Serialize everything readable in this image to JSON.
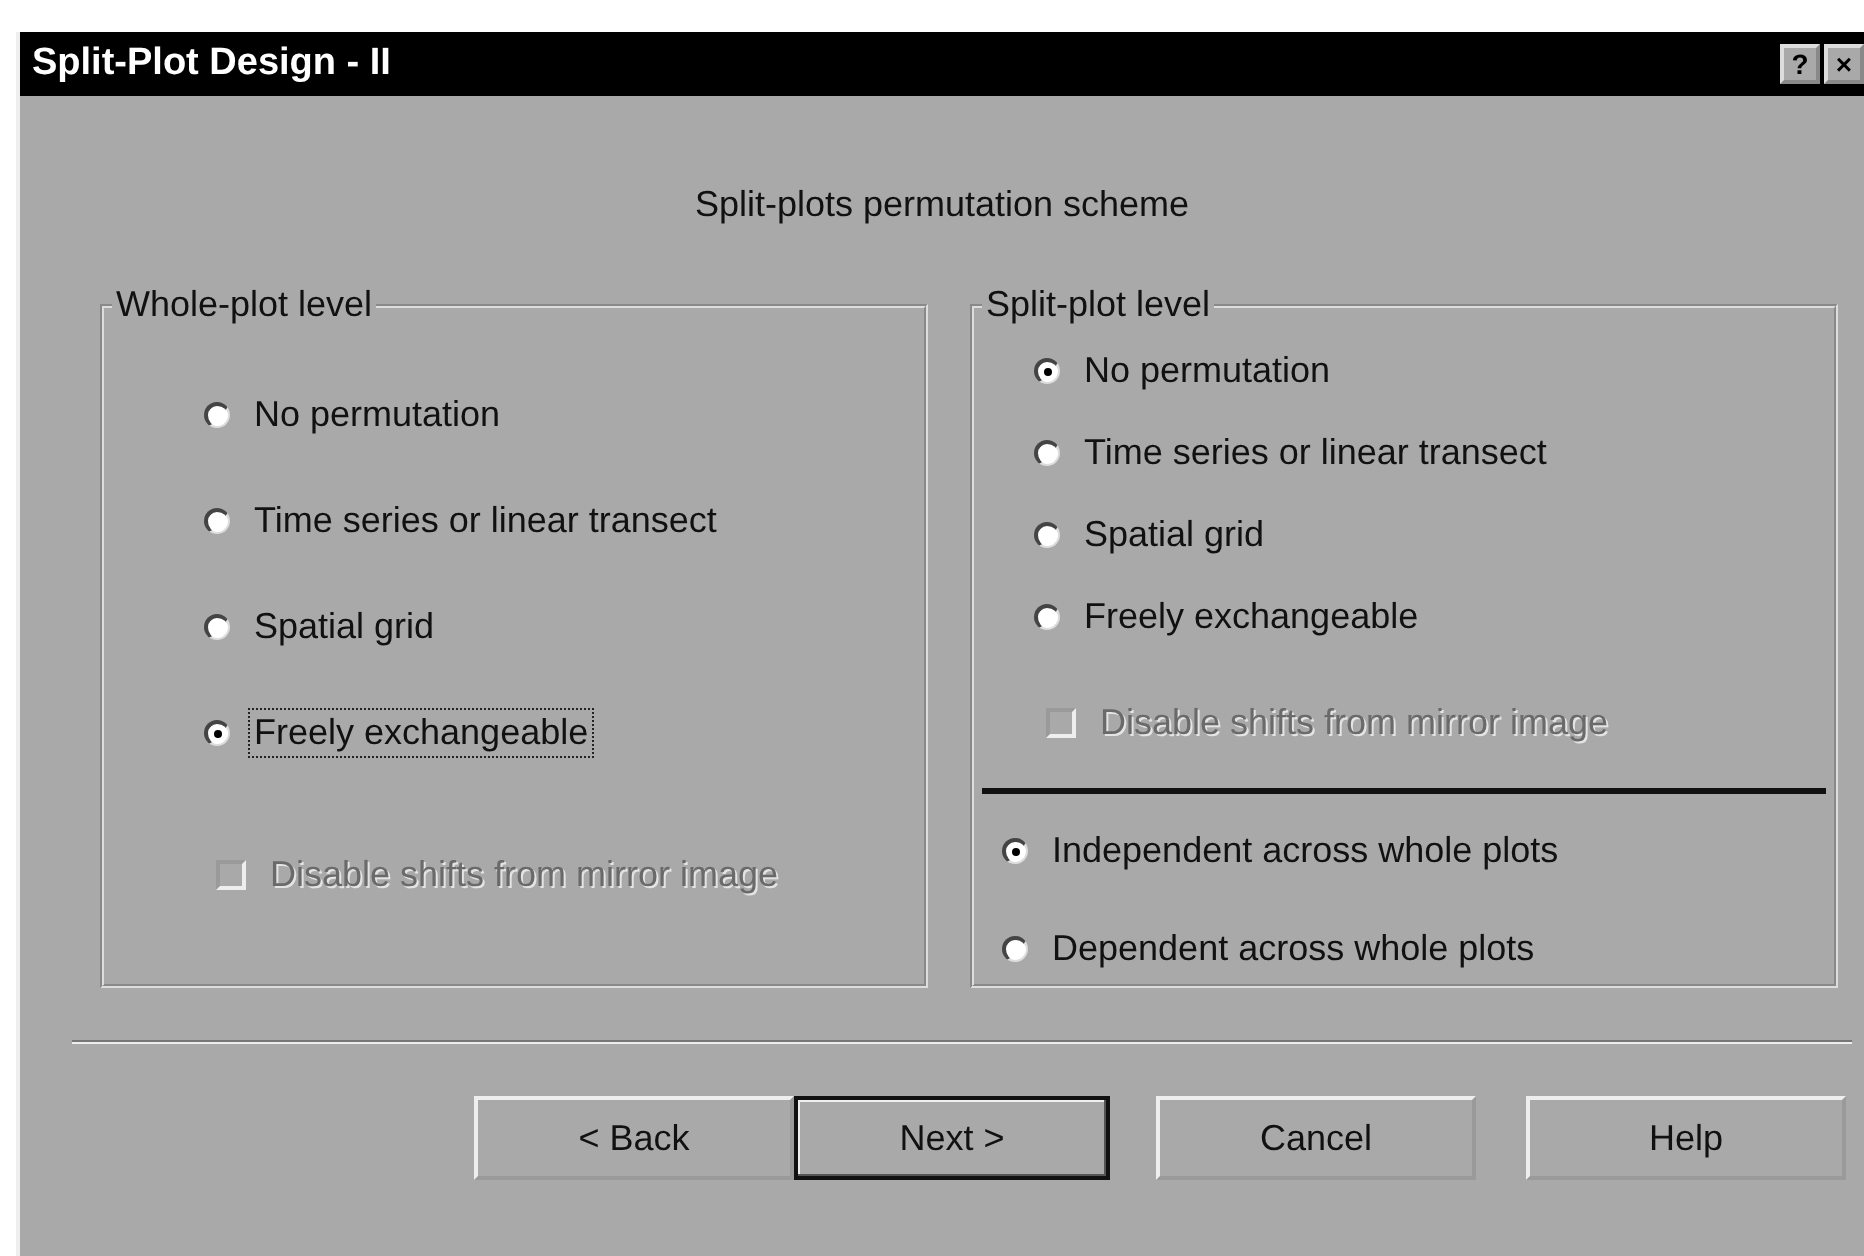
{
  "window": {
    "title": "Split-Plot Design - II",
    "title_buttons": [
      "?",
      "×"
    ]
  },
  "heading": "Split-plots permutation scheme",
  "groups": [
    {
      "title": "Whole-plot level",
      "sections": [
        {
          "options": [
            {
              "label": "No permutation",
              "selected": false
            },
            {
              "label": "Time series or linear transect",
              "selected": false
            },
            {
              "label": "Spatial grid",
              "selected": false
            },
            {
              "label": "Freely exchangeable",
              "selected": true,
              "focused": true
            }
          ],
          "checkbox": {
            "label": "Disable shifts from mirror image",
            "checked": false,
            "disabled": true
          }
        }
      ]
    },
    {
      "title": "Split-plot level",
      "sections": [
        {
          "options": [
            {
              "label": "No permutation",
              "selected": true
            },
            {
              "label": "Time series or linear transect",
              "selected": false
            },
            {
              "label": "Spatial grid",
              "selected": false
            },
            {
              "label": "Freely exchangeable",
              "selected": false
            }
          ],
          "checkbox": {
            "label": "Disable shifts from mirror image",
            "checked": false,
            "disabled": true
          }
        },
        {
          "options": [
            {
              "label": "Independent across whole plots",
              "selected": true
            },
            {
              "label": "Dependent across whole plots",
              "selected": false
            }
          ]
        }
      ]
    }
  ],
  "buttons": [
    {
      "label": "< Back",
      "default": false
    },
    {
      "label": "Next >",
      "default": true
    },
    {
      "label": "Cancel",
      "default": false
    },
    {
      "label": "Help",
      "default": false
    }
  ]
}
